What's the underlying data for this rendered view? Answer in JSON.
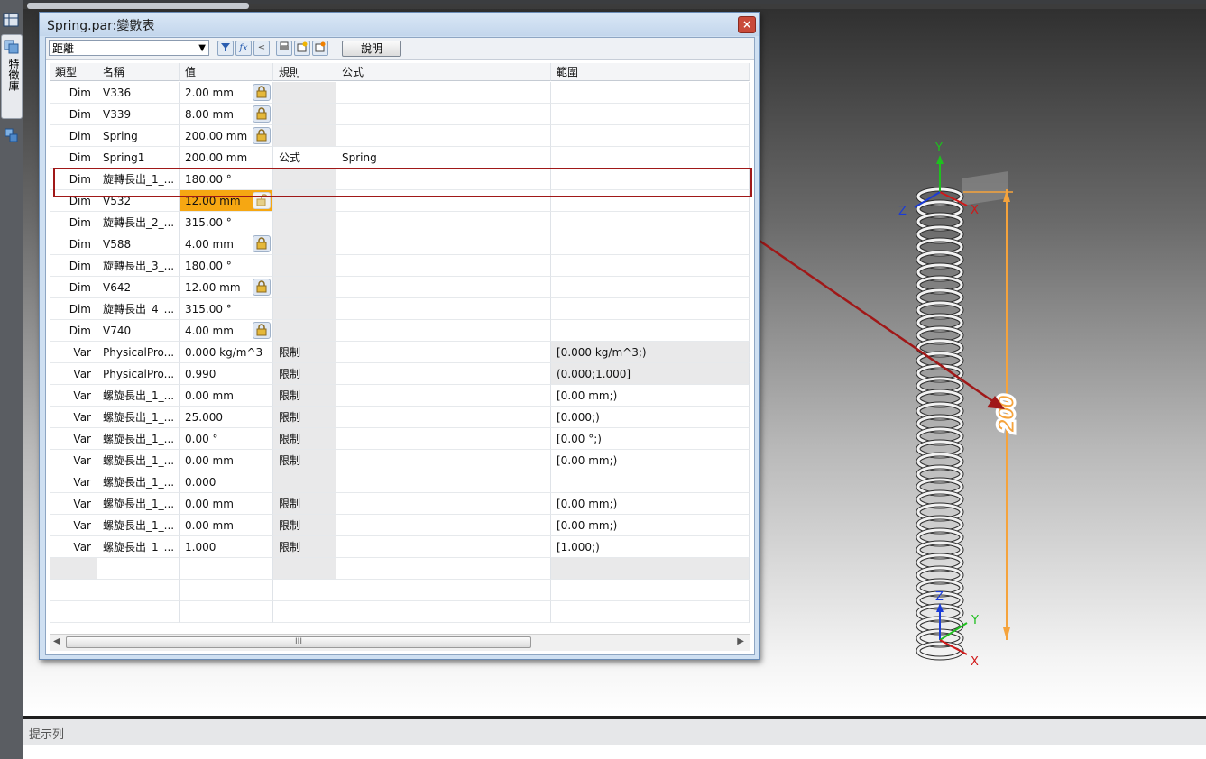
{
  "window": {
    "title": "Spring.par:變數表",
    "close_glyph": "×"
  },
  "sidebar": {
    "tab_label": "特徵庫"
  },
  "toolbar": {
    "filter_value": "距離",
    "help_label": "說明",
    "icons": [
      "filter-icon",
      "formula-icon",
      "function-icon",
      "print-icon",
      "add-variable-icon",
      "export-icon"
    ]
  },
  "table": {
    "headers": {
      "type": "類型",
      "name": "名稱",
      "value": "值",
      "rule": "規則",
      "formula": "公式",
      "range": "範圍"
    },
    "rows": [
      {
        "type": "Dim",
        "name": "V336",
        "value": "2.00 mm",
        "rule": "",
        "formula": "",
        "range": "",
        "lock": "locked"
      },
      {
        "type": "Dim",
        "name": "V339",
        "value": "8.00 mm",
        "rule": "",
        "formula": "",
        "range": "",
        "lock": "locked"
      },
      {
        "type": "Dim",
        "name": "Spring",
        "value": "200.00 mm",
        "rule": "",
        "formula": "",
        "range": "",
        "lock": "locked"
      },
      {
        "type": "Dim",
        "name": "Spring1",
        "value": "200.00 mm",
        "rule": "公式",
        "formula": "Spring",
        "range": "",
        "lock": "none",
        "selected": true
      },
      {
        "type": "Dim",
        "name": "旋轉長出_1_...",
        "value": "180.00 °",
        "rule": "",
        "formula": "",
        "range": "",
        "lock": "none"
      },
      {
        "type": "Dim",
        "name": "V532",
        "value": "12.00 mm",
        "rule": "",
        "formula": "",
        "range": "",
        "lock": "unlocked",
        "highlight": true
      },
      {
        "type": "Dim",
        "name": "旋轉長出_2_...",
        "value": "315.00 °",
        "rule": "",
        "formula": "",
        "range": "",
        "lock": "none"
      },
      {
        "type": "Dim",
        "name": "V588",
        "value": "4.00 mm",
        "rule": "",
        "formula": "",
        "range": "",
        "lock": "locked"
      },
      {
        "type": "Dim",
        "name": "旋轉長出_3_...",
        "value": "180.00 °",
        "rule": "",
        "formula": "",
        "range": "",
        "lock": "none"
      },
      {
        "type": "Dim",
        "name": "V642",
        "value": "12.00 mm",
        "rule": "",
        "formula": "",
        "range": "",
        "lock": "locked"
      },
      {
        "type": "Dim",
        "name": "旋轉長出_4_...",
        "value": "315.00 °",
        "rule": "",
        "formula": "",
        "range": "",
        "lock": "none"
      },
      {
        "type": "Dim",
        "name": "V740",
        "value": "4.00 mm",
        "rule": "",
        "formula": "",
        "range": "",
        "lock": "locked"
      },
      {
        "type": "Var",
        "name": "PhysicalPro...",
        "value": "0.000 kg/m^3",
        "rule": "限制",
        "formula": "",
        "range": "[0.000 kg/m^3;)",
        "lock": "none",
        "range_shaded": true
      },
      {
        "type": "Var",
        "name": "PhysicalPro...",
        "value": "0.990",
        "rule": "限制",
        "formula": "",
        "range": "(0.000;1.000]",
        "lock": "none",
        "range_shaded": true
      },
      {
        "type": "Var",
        "name": "螺旋長出_1_...",
        "value": "0.00 mm",
        "rule": "限制",
        "formula": "",
        "range": "[0.00 mm;)",
        "lock": "none"
      },
      {
        "type": "Var",
        "name": "螺旋長出_1_...",
        "value": "25.000",
        "rule": "限制",
        "formula": "",
        "range": "[0.000;)",
        "lock": "none"
      },
      {
        "type": "Var",
        "name": "螺旋長出_1_...",
        "value": "0.00 °",
        "rule": "限制",
        "formula": "",
        "range": "[0.00 °;)",
        "lock": "none"
      },
      {
        "type": "Var",
        "name": "螺旋長出_1_...",
        "value": "0.00 mm",
        "rule": "限制",
        "formula": "",
        "range": "[0.00 mm;)",
        "lock": "none"
      },
      {
        "type": "Var",
        "name": "螺旋長出_1_...",
        "value": "0.000",
        "rule": "",
        "formula": "",
        "range": "",
        "lock": "none"
      },
      {
        "type": "Var",
        "name": "螺旋長出_1_...",
        "value": "0.00 mm",
        "rule": "限制",
        "formula": "",
        "range": "[0.00 mm;)",
        "lock": "none"
      },
      {
        "type": "Var",
        "name": "螺旋長出_1_...",
        "value": "0.00 mm",
        "rule": "限制",
        "formula": "",
        "range": "[0.00 mm;)",
        "lock": "none"
      },
      {
        "type": "Var",
        "name": "螺旋長出_1_...",
        "value": "1.000",
        "rule": "限制",
        "formula": "",
        "range": "[1.000;)",
        "lock": "none"
      }
    ]
  },
  "scrollbar": {
    "thumb_grip": "III",
    "left_arrow": "◀",
    "right_arrow": "▶"
  },
  "viewport": {
    "dimension_label": "200",
    "triad_top": {
      "y": "Y",
      "x": "X",
      "z": "Z"
    },
    "triad_bottom": {
      "z": "Z",
      "y": "Y",
      "x": "X"
    }
  },
  "prompt_bar": {
    "label": "提示列"
  },
  "colors": {
    "dimension": "#f5a33c",
    "callout": "#a01818",
    "highlight_cell": "#f6a712"
  }
}
